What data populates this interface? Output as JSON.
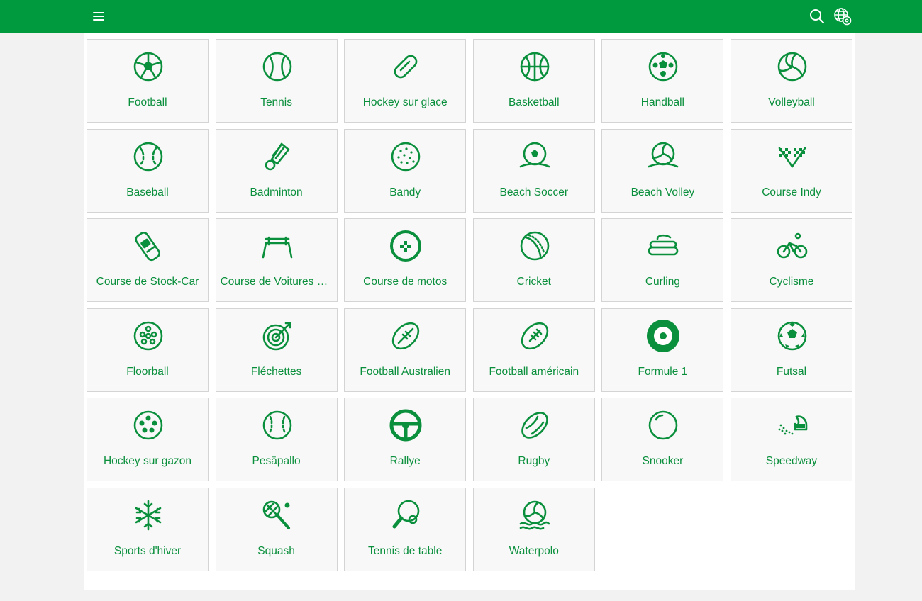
{
  "header": {
    "menu_icon": "hamburger-menu-icon",
    "search_icon": "search-icon",
    "language_icon": "globe-settings-icon"
  },
  "colors": {
    "brand_green": "#009a3e",
    "text_green": "#0a8f3c",
    "tile_bg": "#f8f8f8",
    "tile_border": "#d4d4d4"
  },
  "sports": [
    {
      "label": "Football",
      "icon": "football"
    },
    {
      "label": "Tennis",
      "icon": "tennis"
    },
    {
      "label": "Hockey sur glace",
      "icon": "ice-hockey"
    },
    {
      "label": "Basketball",
      "icon": "basketball"
    },
    {
      "label": "Handball",
      "icon": "handball"
    },
    {
      "label": "Volleyball",
      "icon": "volleyball"
    },
    {
      "label": "Baseball",
      "icon": "baseball"
    },
    {
      "label": "Badminton",
      "icon": "badminton"
    },
    {
      "label": "Bandy",
      "icon": "bandy"
    },
    {
      "label": "Beach Soccer",
      "icon": "beach-soccer"
    },
    {
      "label": "Beach Volley",
      "icon": "beach-volley"
    },
    {
      "label": "Course Indy",
      "icon": "indy-flags"
    },
    {
      "label": "Course de Stock-Car",
      "icon": "stock-car"
    },
    {
      "label": "Course de Voitures de Tourisme",
      "icon": "touring-car"
    },
    {
      "label": "Course de motos",
      "icon": "moto"
    },
    {
      "label": "Cricket",
      "icon": "cricket"
    },
    {
      "label": "Curling",
      "icon": "curling"
    },
    {
      "label": "Cyclisme",
      "icon": "cycling"
    },
    {
      "label": "Floorball",
      "icon": "floorball"
    },
    {
      "label": "Fléchettes",
      "icon": "darts"
    },
    {
      "label": "Football Australien",
      "icon": "aussie-rules"
    },
    {
      "label": "Football américain",
      "icon": "american-football"
    },
    {
      "label": "Formule 1",
      "icon": "formula-1"
    },
    {
      "label": "Futsal",
      "icon": "futsal"
    },
    {
      "label": "Hockey sur gazon",
      "icon": "field-hockey"
    },
    {
      "label": "Pesäpallo",
      "icon": "pesapallo"
    },
    {
      "label": "Rallye",
      "icon": "rally"
    },
    {
      "label": "Rugby",
      "icon": "rugby"
    },
    {
      "label": "Snooker",
      "icon": "snooker"
    },
    {
      "label": "Speedway",
      "icon": "speedway"
    },
    {
      "label": "Sports d'hiver",
      "icon": "snowflake"
    },
    {
      "label": "Squash",
      "icon": "squash"
    },
    {
      "label": "Tennis de table",
      "icon": "table-tennis"
    },
    {
      "label": "Waterpolo",
      "icon": "waterpolo"
    }
  ]
}
